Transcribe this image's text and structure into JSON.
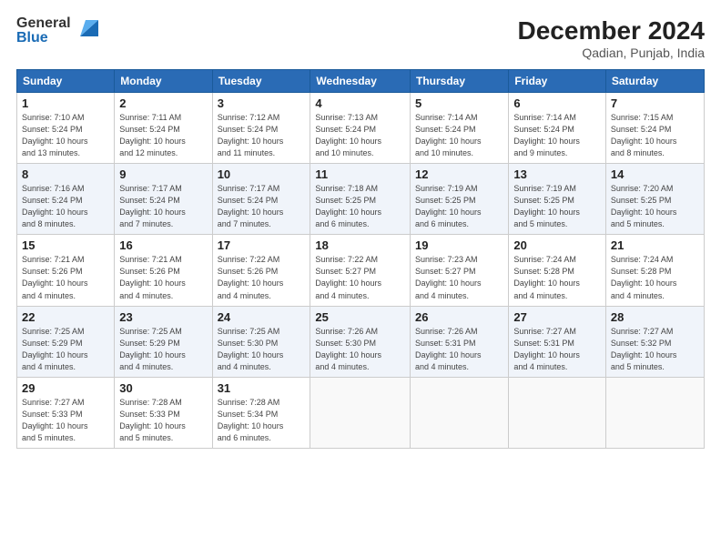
{
  "logo": {
    "general": "General",
    "blue": "Blue"
  },
  "title": "December 2024",
  "location": "Qadian, Punjab, India",
  "days_header": [
    "Sunday",
    "Monday",
    "Tuesday",
    "Wednesday",
    "Thursday",
    "Friday",
    "Saturday"
  ],
  "weeks": [
    [
      {
        "day": "1",
        "info": "Sunrise: 7:10 AM\nSunset: 5:24 PM\nDaylight: 10 hours\nand 13 minutes."
      },
      {
        "day": "2",
        "info": "Sunrise: 7:11 AM\nSunset: 5:24 PM\nDaylight: 10 hours\nand 12 minutes."
      },
      {
        "day": "3",
        "info": "Sunrise: 7:12 AM\nSunset: 5:24 PM\nDaylight: 10 hours\nand 11 minutes."
      },
      {
        "day": "4",
        "info": "Sunrise: 7:13 AM\nSunset: 5:24 PM\nDaylight: 10 hours\nand 10 minutes."
      },
      {
        "day": "5",
        "info": "Sunrise: 7:14 AM\nSunset: 5:24 PM\nDaylight: 10 hours\nand 10 minutes."
      },
      {
        "day": "6",
        "info": "Sunrise: 7:14 AM\nSunset: 5:24 PM\nDaylight: 10 hours\nand 9 minutes."
      },
      {
        "day": "7",
        "info": "Sunrise: 7:15 AM\nSunset: 5:24 PM\nDaylight: 10 hours\nand 8 minutes."
      }
    ],
    [
      {
        "day": "8",
        "info": "Sunrise: 7:16 AM\nSunset: 5:24 PM\nDaylight: 10 hours\nand 8 minutes."
      },
      {
        "day": "9",
        "info": "Sunrise: 7:17 AM\nSunset: 5:24 PM\nDaylight: 10 hours\nand 7 minutes."
      },
      {
        "day": "10",
        "info": "Sunrise: 7:17 AM\nSunset: 5:24 PM\nDaylight: 10 hours\nand 7 minutes."
      },
      {
        "day": "11",
        "info": "Sunrise: 7:18 AM\nSunset: 5:25 PM\nDaylight: 10 hours\nand 6 minutes."
      },
      {
        "day": "12",
        "info": "Sunrise: 7:19 AM\nSunset: 5:25 PM\nDaylight: 10 hours\nand 6 minutes."
      },
      {
        "day": "13",
        "info": "Sunrise: 7:19 AM\nSunset: 5:25 PM\nDaylight: 10 hours\nand 5 minutes."
      },
      {
        "day": "14",
        "info": "Sunrise: 7:20 AM\nSunset: 5:25 PM\nDaylight: 10 hours\nand 5 minutes."
      }
    ],
    [
      {
        "day": "15",
        "info": "Sunrise: 7:21 AM\nSunset: 5:26 PM\nDaylight: 10 hours\nand 4 minutes."
      },
      {
        "day": "16",
        "info": "Sunrise: 7:21 AM\nSunset: 5:26 PM\nDaylight: 10 hours\nand 4 minutes."
      },
      {
        "day": "17",
        "info": "Sunrise: 7:22 AM\nSunset: 5:26 PM\nDaylight: 10 hours\nand 4 minutes."
      },
      {
        "day": "18",
        "info": "Sunrise: 7:22 AM\nSunset: 5:27 PM\nDaylight: 10 hours\nand 4 minutes."
      },
      {
        "day": "19",
        "info": "Sunrise: 7:23 AM\nSunset: 5:27 PM\nDaylight: 10 hours\nand 4 minutes."
      },
      {
        "day": "20",
        "info": "Sunrise: 7:24 AM\nSunset: 5:28 PM\nDaylight: 10 hours\nand 4 minutes."
      },
      {
        "day": "21",
        "info": "Sunrise: 7:24 AM\nSunset: 5:28 PM\nDaylight: 10 hours\nand 4 minutes."
      }
    ],
    [
      {
        "day": "22",
        "info": "Sunrise: 7:25 AM\nSunset: 5:29 PM\nDaylight: 10 hours\nand 4 minutes."
      },
      {
        "day": "23",
        "info": "Sunrise: 7:25 AM\nSunset: 5:29 PM\nDaylight: 10 hours\nand 4 minutes."
      },
      {
        "day": "24",
        "info": "Sunrise: 7:25 AM\nSunset: 5:30 PM\nDaylight: 10 hours\nand 4 minutes."
      },
      {
        "day": "25",
        "info": "Sunrise: 7:26 AM\nSunset: 5:30 PM\nDaylight: 10 hours\nand 4 minutes."
      },
      {
        "day": "26",
        "info": "Sunrise: 7:26 AM\nSunset: 5:31 PM\nDaylight: 10 hours\nand 4 minutes."
      },
      {
        "day": "27",
        "info": "Sunrise: 7:27 AM\nSunset: 5:31 PM\nDaylight: 10 hours\nand 4 minutes."
      },
      {
        "day": "28",
        "info": "Sunrise: 7:27 AM\nSunset: 5:32 PM\nDaylight: 10 hours\nand 5 minutes."
      }
    ],
    [
      {
        "day": "29",
        "info": "Sunrise: 7:27 AM\nSunset: 5:33 PM\nDaylight: 10 hours\nand 5 minutes."
      },
      {
        "day": "30",
        "info": "Sunrise: 7:28 AM\nSunset: 5:33 PM\nDaylight: 10 hours\nand 5 minutes."
      },
      {
        "day": "31",
        "info": "Sunrise: 7:28 AM\nSunset: 5:34 PM\nDaylight: 10 hours\nand 6 minutes."
      },
      {
        "day": "",
        "info": ""
      },
      {
        "day": "",
        "info": ""
      },
      {
        "day": "",
        "info": ""
      },
      {
        "day": "",
        "info": ""
      }
    ]
  ]
}
